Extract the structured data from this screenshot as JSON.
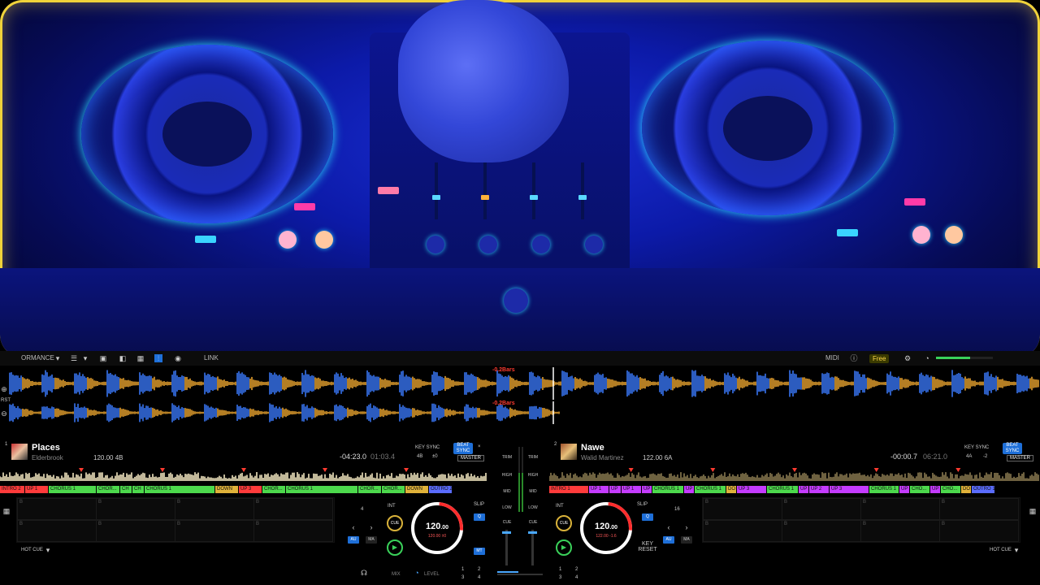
{
  "toolbar": {
    "mode": "ORMANCE",
    "link": "LINK",
    "midi": "MIDI",
    "free": "Free"
  },
  "waveform": {
    "label_a": "-0.2Bars",
    "label_b": "-0.2Bars",
    "row_labels": [
      "RST"
    ]
  },
  "deck1": {
    "number": "1",
    "title": "Places",
    "artist": "Elderbrook",
    "bpm_key": "120.00 4B",
    "remaining": "-04:23.0",
    "elapsed": "01:03.4",
    "key_sync": "KEY SYNC",
    "key_value": "4B",
    "key_offset": "±0",
    "beat_sync": "BEAT SYNC",
    "master": "MASTER",
    "close": "×",
    "phrases": [
      {
        "label": "INTRO 2",
        "color": "#ff3b3b",
        "w": 30
      },
      {
        "label": "UP 1",
        "color": "#ff3b3b",
        "w": 28
      },
      {
        "label": "CHORUS 1",
        "color": "#4cd94c",
        "w": 58
      },
      {
        "label": "CHOR...",
        "color": "#4cd94c",
        "w": 28
      },
      {
        "label": "CH",
        "color": "#4cd94c",
        "w": 14
      },
      {
        "label": "CH",
        "color": "#4cd94c",
        "w": 14
      },
      {
        "label": "CHORUS 1",
        "color": "#4cd94c",
        "w": 86
      },
      {
        "label": "DOWN",
        "color": "#e0b23a",
        "w": 28
      },
      {
        "label": "UP 3",
        "color": "#ff3b3b",
        "w": 28
      },
      {
        "label": "CHOR...",
        "color": "#4cd94c",
        "w": 28
      },
      {
        "label": "CHORUS 1",
        "color": "#4cd94c",
        "w": 88
      },
      {
        "label": "CHOR...",
        "color": "#4cd94c",
        "w": 28
      },
      {
        "label": "CHOR...",
        "color": "#4cd94c",
        "w": 28
      },
      {
        "label": "DOWN",
        "color": "#e0b23a",
        "w": 28
      },
      {
        "label": "OUTRO 2",
        "color": "#5a6cff",
        "w": 28
      }
    ],
    "hot_cue": "HOT CUE",
    "beats": "4",
    "int": "INT",
    "cue": "CUE",
    "au": "AU",
    "ma": "MA",
    "mt": "MT",
    "slip": "SLIP",
    "q": "Q",
    "platter_bpm": "120",
    "platter_bpm_dec": ".00",
    "platter_sub": "120.00  ±0"
  },
  "deck2": {
    "number": "2",
    "title": "Nawe",
    "artist": "Walid Martinez",
    "bpm_key": "122.00 6A",
    "remaining": "-00:00.7",
    "elapsed": "06:21.0",
    "key_sync": "KEY SYNC",
    "key_value": "4A",
    "key_offset": "-2",
    "beat_sync": "BEAT SYNC",
    "master": "MASTER",
    "phrases": [
      {
        "label": "INTRO 1",
        "color": "#ff3b3b",
        "w": 48
      },
      {
        "label": "UP 1",
        "color": "#c43bff",
        "w": 24
      },
      {
        "label": "UP",
        "color": "#c43bff",
        "w": 14
      },
      {
        "label": "UP 1",
        "color": "#c43bff",
        "w": 24
      },
      {
        "label": "UP",
        "color": "#c43bff",
        "w": 12
      },
      {
        "label": "CHORUS 1",
        "color": "#4cd94c",
        "w": 38
      },
      {
        "label": "UP",
        "color": "#c43bff",
        "w": 12
      },
      {
        "label": "CHORUS 1",
        "color": "#4cd94c",
        "w": 38
      },
      {
        "label": "DO",
        "color": "#e0b23a",
        "w": 12
      },
      {
        "label": "UP 3",
        "color": "#c43bff",
        "w": 36
      },
      {
        "label": "CHORUS 1",
        "color": "#4cd94c",
        "w": 38
      },
      {
        "label": "UP",
        "color": "#c43bff",
        "w": 12
      },
      {
        "label": "UP 2",
        "color": "#c43bff",
        "w": 24
      },
      {
        "label": "UP 3",
        "color": "#c43bff",
        "w": 48
      },
      {
        "label": "CHORUS 1",
        "color": "#4cd94c",
        "w": 36
      },
      {
        "label": "UP",
        "color": "#c43bff",
        "w": 12
      },
      {
        "label": "CHO...",
        "color": "#4cd94c",
        "w": 24
      },
      {
        "label": "UP",
        "color": "#c43bff",
        "w": 12
      },
      {
        "label": "CHO...",
        "color": "#4cd94c",
        "w": 24
      },
      {
        "label": "DO",
        "color": "#e0b23a",
        "w": 12
      },
      {
        "label": "OUTRO 1",
        "color": "#5a6cff",
        "w": 28
      }
    ],
    "hot_cue": "HOT CUE",
    "beats": "16",
    "int": "INT",
    "cue": "CUE",
    "au": "AU",
    "ma": "MA",
    "slip": "SLIP",
    "q": "Q",
    "key_reset": "KEY RESET",
    "platter_bpm": "120",
    "platter_bpm_dec": ".00",
    "platter_sub": "122.00  -1.6"
  },
  "mixer": {
    "trim": "TRIM",
    "high": "HIGH",
    "mid": "MID",
    "low": "LOW",
    "cue": "CUE",
    "mix": "MIX",
    "level": "LEVEL",
    "pads_left": [
      "1",
      "2",
      "3",
      "4"
    ],
    "pads_right": [
      "1",
      "2",
      "3",
      "4"
    ]
  },
  "colors": {
    "accent_blue": "#1e6fd8",
    "wave_orange": "#f0a830",
    "wave_blue": "#3a7bff",
    "red": "#ff3b30",
    "green": "#3ad15a",
    "frame_yellow": "#f0d23a"
  }
}
